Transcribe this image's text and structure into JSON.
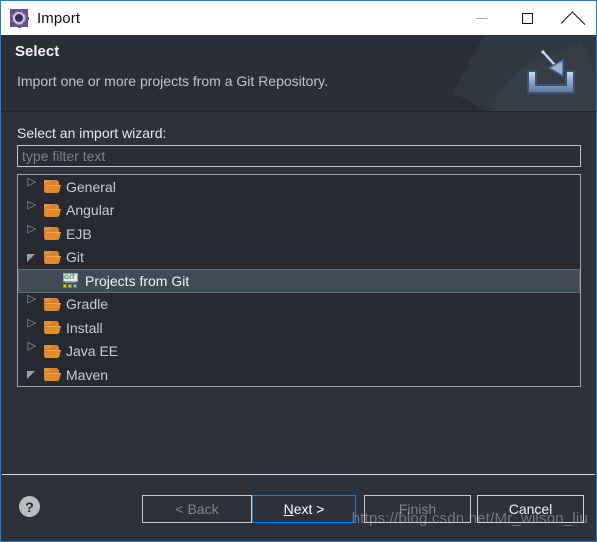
{
  "window": {
    "title": "Import",
    "app_icon": "eclipse-icon",
    "accent_border": "#1a7fd4",
    "controls": {
      "minimize": "minimize-icon",
      "maximize": "maximize-icon",
      "close": "close-icon"
    }
  },
  "banner": {
    "title": "Select",
    "subtitle": "Import one or more projects from a Git Repository.",
    "art": "import-tray-icon",
    "background": "#2b2f35"
  },
  "page": {
    "label": "Select an import wizard:",
    "filter": {
      "value": "",
      "placeholder": "type filter text"
    },
    "tree": {
      "selection_color": "#414b56",
      "folder_color": "#d9822b",
      "items": [
        {
          "label": "General",
          "icon": "folder-icon",
          "state": "collapsed",
          "indent": 0,
          "selected": false
        },
        {
          "label": "Angular",
          "icon": "folder-icon",
          "state": "collapsed",
          "indent": 0,
          "selected": false
        },
        {
          "label": "EJB",
          "icon": "folder-icon",
          "state": "collapsed",
          "indent": 0,
          "selected": false
        },
        {
          "label": "Git",
          "icon": "folder-icon",
          "state": "expanded",
          "indent": 0,
          "selected": false
        },
        {
          "label": "Projects from Git",
          "icon": "git-icon",
          "state": "leaf",
          "indent": 1,
          "selected": true
        },
        {
          "label": "Gradle",
          "icon": "folder-icon",
          "state": "collapsed",
          "indent": 0,
          "selected": false
        },
        {
          "label": "Install",
          "icon": "folder-icon",
          "state": "collapsed",
          "indent": 0,
          "selected": false
        },
        {
          "label": "Java EE",
          "icon": "folder-icon",
          "state": "collapsed",
          "indent": 0,
          "selected": false
        },
        {
          "label": "Maven",
          "icon": "folder-icon",
          "state": "expanded",
          "indent": 0,
          "selected": false
        }
      ]
    }
  },
  "buttonbar": {
    "help": "?",
    "buttons": [
      {
        "id": "back",
        "label": "< Back",
        "enabled": false,
        "focused": false
      },
      {
        "id": "next",
        "label": "Next >",
        "enabled": true,
        "focused": true,
        "mnemonic": "N"
      },
      {
        "id": "finish",
        "label": "Finish",
        "enabled": false,
        "focused": false
      },
      {
        "id": "cancel",
        "label": "Cancel",
        "enabled": true,
        "focused": false
      }
    ]
  },
  "watermark": {
    "text": "https://blog.csdn.net/Mr_wilson_liu"
  }
}
